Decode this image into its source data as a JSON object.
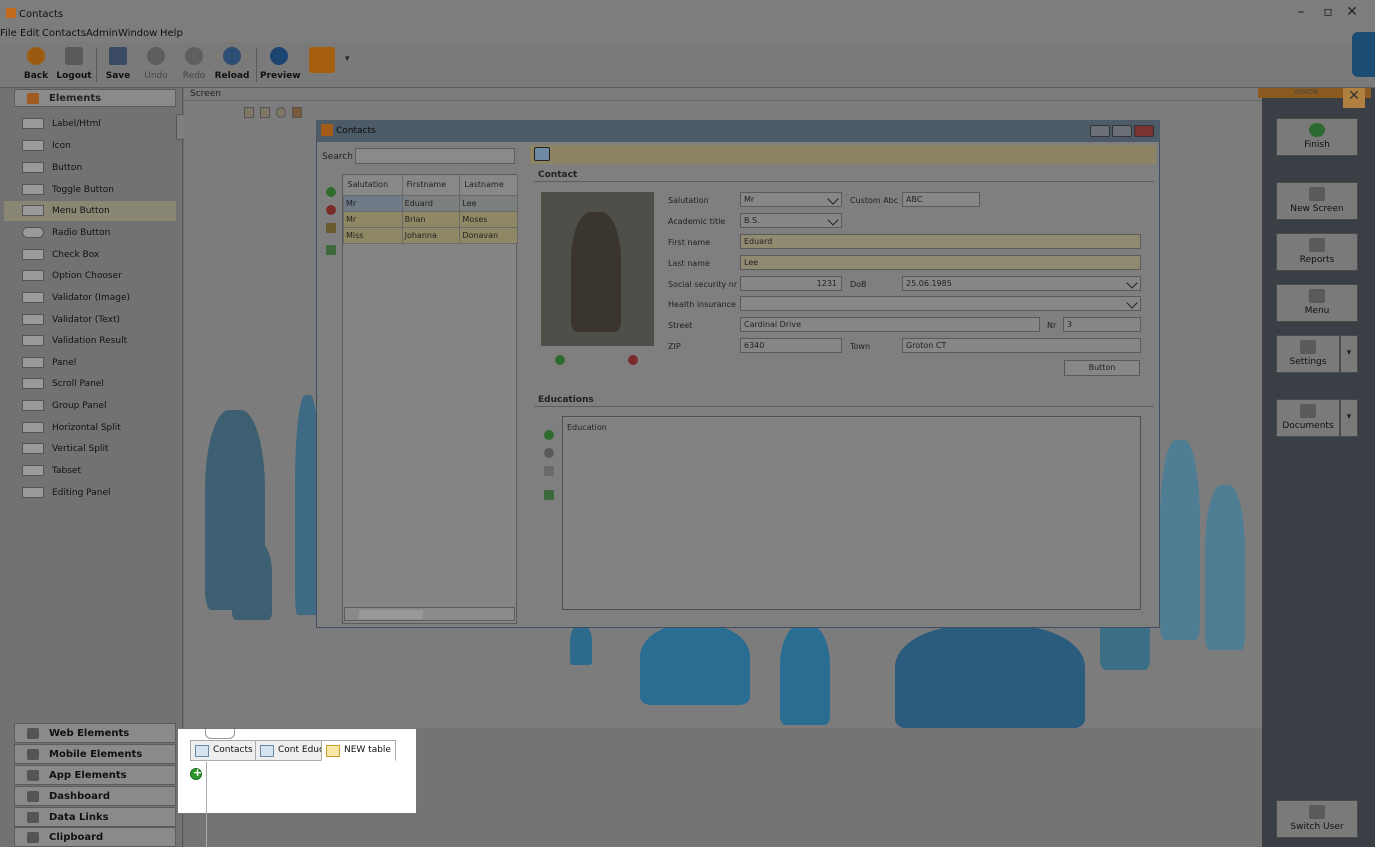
{
  "window": {
    "title": "Contacts",
    "controls": [
      "–",
      "▫",
      "✕"
    ]
  },
  "menu": [
    "File",
    "Edit",
    "Contacts",
    "Admin",
    "Window",
    "Help"
  ],
  "toolbar": {
    "back": "Back",
    "logout": "Logout",
    "save": "Save",
    "undo": "Undo",
    "redo": "Redo",
    "reload": "Reload",
    "preview": "Preview"
  },
  "left_panel": {
    "elements_header": "Elements",
    "items": [
      "Label/Html",
      "Icon",
      "Button",
      "Toggle Button",
      "Menu Button",
      "Radio Button",
      "Check Box",
      "Option Chooser",
      "Validator (Image)",
      "Validator (Text)",
      "Validation Result",
      "Panel",
      "Scroll Panel",
      "Group Panel",
      "Horizontal Split",
      "Vertical Split",
      "Tabset",
      "Editing Panel"
    ],
    "sections": [
      "Web Elements",
      "Mobile Elements",
      "App Elements",
      "Dashboard",
      "Data Links",
      "Clipboard"
    ]
  },
  "canvas": {
    "tab": "Screen"
  },
  "dialog": {
    "title": "Contacts",
    "search_label": "Search",
    "table": {
      "headers": [
        "Salutation",
        "Firstname",
        "Lastname"
      ],
      "rows": [
        [
          "Mr",
          "Eduard",
          "Lee"
        ],
        [
          "Mr",
          "Brian",
          "Moses"
        ],
        [
          "Miss",
          "Johanna",
          "Donavan"
        ]
      ]
    },
    "contact_section": "Contact",
    "fields": {
      "salutation_label": "Salutation",
      "salutation": "Mr",
      "custom_abc_label": "Custom Abc",
      "custom_abc": "ABC",
      "academic_title_label": "Academic title",
      "academic_title": "B.S.",
      "first_name_label": "First name",
      "first_name": "Eduard",
      "last_name_label": "Last name",
      "last_name": "Lee",
      "ssn_label": "Social security nr",
      "ssn": "1231",
      "dob_label": "DoB",
      "dob": "25.06.1985",
      "health_label": "Health insurance",
      "health": "",
      "street_label": "Street",
      "street": "Cardinal Drive",
      "nr_label": "Nr",
      "nr": "3",
      "zip_label": "ZIP",
      "zip": "6340",
      "town_label": "Town",
      "town": "Groton CT"
    },
    "button_label": "Button",
    "educations_section": "Educations",
    "education_header": "Education"
  },
  "right_panel": {
    "vision_label": "VISION",
    "finish": "Finish",
    "new_screen": "New Screen",
    "reports": "Reports",
    "menu": "Menu",
    "settings": "Settings",
    "documents": "Documents",
    "switch_user": "Switch User"
  },
  "popup": {
    "tabs": [
      "Contacts",
      "Cont Educ",
      "NEW table"
    ]
  },
  "colors": {
    "overlay": "#6f6f6f",
    "accent": "#1b4d72",
    "active_tab": "#f6e7a8"
  }
}
